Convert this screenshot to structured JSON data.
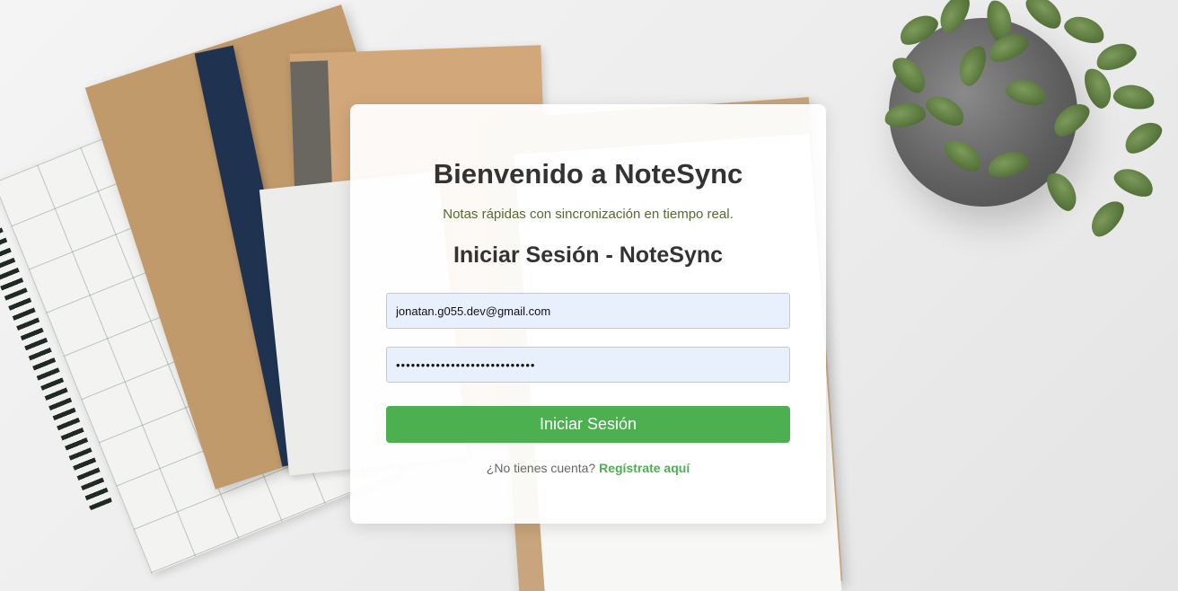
{
  "header": {
    "title": "Bienvenido a NoteSync",
    "tagline": "Notas rápidas con sincronización en tiempo real."
  },
  "login_form": {
    "title": "Iniciar Sesión - NoteSync",
    "email_value": "jonatan.g055.dev@gmail.com",
    "password_value": "••••••••••••••••••••••••••••",
    "submit_label": "Iniciar Sesión"
  },
  "register": {
    "prompt": "¿No tienes cuenta?",
    "link_label": "Regístrate aquí"
  },
  "colors": {
    "accent": "#4caf50",
    "tagline": "#556b2f",
    "heading": "#333333",
    "input_background": "#e8f0fe"
  }
}
